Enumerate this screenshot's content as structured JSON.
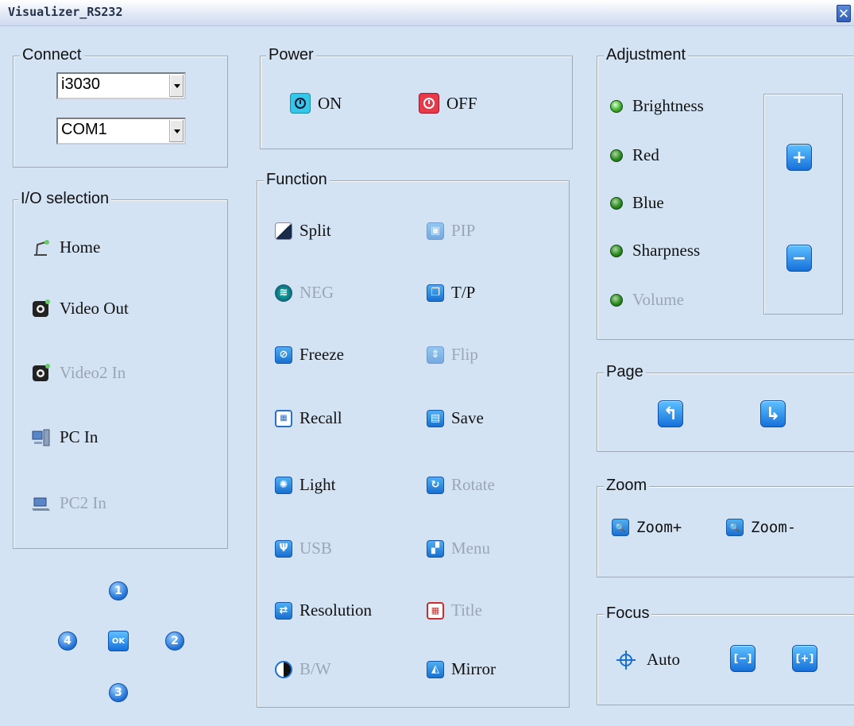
{
  "window": {
    "title": "Visualizer_RS232",
    "close": "✕"
  },
  "connect": {
    "legend": "Connect",
    "model": "i3030",
    "port": "COM1"
  },
  "io": {
    "legend": "I/O selection",
    "items": [
      {
        "label": "Home",
        "enabled": true
      },
      {
        "label": "Video Out",
        "enabled": true
      },
      {
        "label": "Video2 In",
        "enabled": false
      },
      {
        "label": "PC In",
        "enabled": true
      },
      {
        "label": "PC2 In",
        "enabled": false
      }
    ]
  },
  "nav": {
    "up": "1",
    "right": "2",
    "down": "3",
    "left": "4",
    "ok": "OK"
  },
  "power": {
    "legend": "Power",
    "on": "ON",
    "off": "OFF"
  },
  "function": {
    "legend": "Function",
    "items": [
      {
        "label": "Split",
        "enabled": true
      },
      {
        "label": "PIP",
        "enabled": false
      },
      {
        "label": "NEG",
        "enabled": false
      },
      {
        "label": "T/P",
        "enabled": true
      },
      {
        "label": "Freeze",
        "enabled": true
      },
      {
        "label": "Flip",
        "enabled": false
      },
      {
        "label": "Recall",
        "enabled": true
      },
      {
        "label": "Save",
        "enabled": true
      },
      {
        "label": "Light",
        "enabled": true
      },
      {
        "label": "Rotate",
        "enabled": false
      },
      {
        "label": "USB",
        "enabled": false
      },
      {
        "label": "Menu",
        "enabled": false
      },
      {
        "label": "Resolution",
        "enabled": true
      },
      {
        "label": "Title",
        "enabled": false
      },
      {
        "label": "B/W",
        "enabled": false
      },
      {
        "label": "Mirror",
        "enabled": true
      }
    ]
  },
  "adjustment": {
    "legend": "Adjustment",
    "items": [
      {
        "label": "Brightness",
        "enabled": true
      },
      {
        "label": "Red",
        "enabled": true
      },
      {
        "label": "Blue",
        "enabled": true
      },
      {
        "label": "Sharpness",
        "enabled": true
      },
      {
        "label": "Volume",
        "enabled": false
      }
    ],
    "plus": "+",
    "minus": "−"
  },
  "page": {
    "legend": "Page"
  },
  "zoom": {
    "legend": "Zoom",
    "in": "Zoom+",
    "out": "Zoom-"
  },
  "focus": {
    "legend": "Focus",
    "auto": "Auto"
  },
  "colors": {
    "background": "#d4e3f4",
    "accent": "#1670da",
    "disabled_text": "#9ba6b4"
  }
}
